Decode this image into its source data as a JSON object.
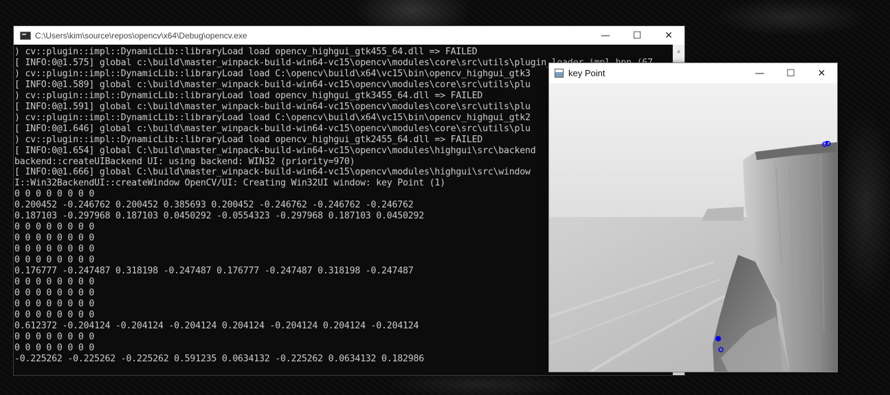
{
  "console": {
    "title": "C:\\Users\\kim\\source\\repos\\opencv\\x64\\Debug\\opencv.exe",
    "controls": {
      "minimize": "—",
      "maximize": "☐",
      "close": "✕"
    },
    "scroll_up": "▲",
    "lines": [
      ") cv::plugin::impl::DynamicLib::libraryLoad load opencv_highgui_gtk455_64.dll => FAILED",
      "[ INFO:0@1.575] global c:\\build\\master_winpack-build-win64-vc15\\opencv\\modules\\core\\src\\utils\\plugin_loader_impl.hpp (67",
      ") cv::plugin::impl::DynamicLib::libraryLoad load C:\\opencv\\build\\x64\\vc15\\bin\\opencv_highgui_gtk3",
      "[ INFO:0@1.589] global c:\\build\\master_winpack-build-win64-vc15\\opencv\\modules\\core\\src\\utils\\plu",
      ") cv::plugin::impl::DynamicLib::libraryLoad load opencv_highgui_gtk3455_64.dll => FAILED",
      "[ INFO:0@1.591] global c:\\build\\master_winpack-build-win64-vc15\\opencv\\modules\\core\\src\\utils\\plu",
      ") cv::plugin::impl::DynamicLib::libraryLoad load C:\\opencv\\build\\x64\\vc15\\bin\\opencv_highgui_gtk2",
      "[ INFO:0@1.646] global c:\\build\\master_winpack-build-win64-vc15\\opencv\\modules\\core\\src\\utils\\plu",
      ") cv::plugin::impl::DynamicLib::libraryLoad load opencv_highgui_gtk2455_64.dll => FAILED",
      "[ INFO:0@1.654] global C:\\build\\master_winpack-build-win64-vc15\\opencv\\modules\\highgui\\src\\backend",
      "backend::createUIBackend UI: using backend: WIN32 (priority=970)",
      "[ INFO:0@1.666] global C:\\build\\master_winpack-build-win64-vc15\\opencv\\modules\\highgui\\src\\window",
      "I::Win32BackendUI::createWindow OpenCV/UI: Creating Win32UI window: key Point (1)",
      "0 0 0 0 0 0 0 0",
      "0.200452 -0.246762 0.200452 0.385693 0.200452 -0.246762 -0.246762 -0.246762",
      "0.187103 -0.297968 0.187103 0.0450292 -0.0554323 -0.297968 0.187103 0.0450292",
      "0 0 0 0 0 0 0 0",
      "0 0 0 0 0 0 0 0",
      "0 0 0 0 0 0 0 0",
      "0 0 0 0 0 0 0 0",
      "0.176777 -0.247487 0.318198 -0.247487 0.176777 -0.247487 0.318198 -0.247487",
      "0 0 0 0 0 0 0 0",
      "0 0 0 0 0 0 0 0",
      "0 0 0 0 0 0 0 0",
      "0 0 0 0 0 0 0 0",
      "0.612372 -0.204124 -0.204124 -0.204124 0.204124 -0.204124 0.204124 -0.204124",
      "0 0 0 0 0 0 0 0",
      "0 0 0 0 0 0 0 0",
      "-0.225262 -0.225262 -0.225262 0.591235 0.0634132 -0.225262 0.0634132 0.182986"
    ]
  },
  "image_window": {
    "title": "key Point",
    "controls": {
      "minimize": "—",
      "maximize": "☐",
      "close": "✕"
    },
    "keypoint_color": "#0000ff"
  }
}
